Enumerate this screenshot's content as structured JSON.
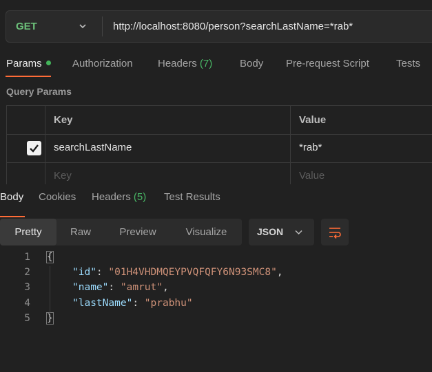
{
  "request": {
    "method": "GET",
    "url": "http://localhost:8080/person?searchLastName=*rab*"
  },
  "request_tabs": [
    {
      "label": "Params",
      "active": true,
      "indicator": "green-dot"
    },
    {
      "label": "Authorization"
    },
    {
      "label": "Headers",
      "count": "(7)"
    },
    {
      "label": "Body"
    },
    {
      "label": "Pre-request Script"
    },
    {
      "label": "Tests"
    }
  ],
  "query_params": {
    "title": "Query Params",
    "columns": [
      "Key",
      "Value"
    ],
    "rows": [
      {
        "checked": true,
        "key": "searchLastName",
        "value": "*rab*"
      }
    ],
    "placeholder": {
      "key": "Key",
      "value": "Value"
    }
  },
  "response_tabs": [
    {
      "label": "Body",
      "active": true
    },
    {
      "label": "Cookies"
    },
    {
      "label": "Headers",
      "count": "(5)"
    },
    {
      "label": "Test Results"
    }
  ],
  "view_modes": [
    "Pretty",
    "Raw",
    "Preview",
    "Visualize"
  ],
  "active_view_mode": "Pretty",
  "format": "JSON",
  "response_body": {
    "line_numbers": [
      "1",
      "2",
      "3",
      "4",
      "5"
    ],
    "open_brace": "{",
    "close_brace": "}",
    "fields": [
      {
        "key": "\"id\"",
        "sep": ": ",
        "value": "\"01H4VHDMQEYPVQFQFY6N93SMC8\"",
        "tail": ","
      },
      {
        "key": "\"name\"",
        "sep": ": ",
        "value": "\"amrut\"",
        "tail": ","
      },
      {
        "key": "\"lastName\"",
        "sep": ": ",
        "value": "\"prabhu\"",
        "tail": ""
      }
    ]
  },
  "colors": {
    "method_get": "#6cc07a",
    "accent_underline": "#ff6c37",
    "count_green": "#49b665",
    "json_key": "#9cdcfe",
    "json_string": "#ce9178",
    "wrap_icon": "#ff6c37"
  },
  "icons": [
    "chevron-down-icon",
    "checkbox-checked-icon",
    "wrap-lines-icon"
  ]
}
